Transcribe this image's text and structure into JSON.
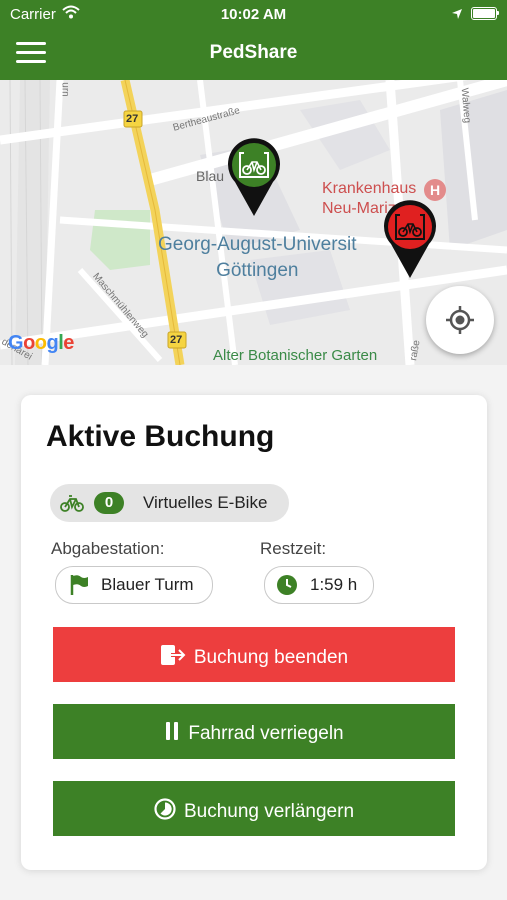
{
  "status_bar": {
    "carrier": "Carrier",
    "time": "10:02 AM"
  },
  "nav": {
    "title": "PedShare"
  },
  "map": {
    "labels": {
      "campus_line1": "Georg-August-Universit",
      "campus_line2": "Göttingen",
      "hospital_line1": "Krankenhaus",
      "hospital_line2": "Neu-Mariz",
      "garden": "Alter Botanischer Garten",
      "blau": "Blau",
      "street_bertheau": "Bertheaustraße",
      "street_muehlen": "Maschmühlenweg",
      "street_wall": "Walweg",
      "street_strasse": "raße",
      "street_denarei": "denarei",
      "street_urn": "urn",
      "route_27_top": "27",
      "route_27_bottom": "27",
      "hospital_marker": "H"
    },
    "google_logo": "Google",
    "colors": {
      "available_pin": "#3d8126",
      "occupied_pin": "#e02020"
    }
  },
  "booking": {
    "title": "Aktive Buchung",
    "bike_count": "0",
    "bike_name": "Virtuelles E-Bike",
    "return_label": "Abgabestation:",
    "return_station": "Blauer Turm",
    "remaining_label": "Restzeit:",
    "remaining_time": "1:59 h",
    "end_button": "Buchung beenden",
    "lock_button": "Fahrrad verriegeln",
    "extend_button": "Buchung verlängern"
  },
  "colors": {
    "brand_green": "#3d8126",
    "danger_red": "#ed3e3e"
  },
  "icons": [
    "menu-icon",
    "wifi-icon",
    "location-arrow-icon",
    "bike-icon",
    "my-location-icon",
    "flag-icon",
    "clock-icon",
    "exit-icon",
    "pause-icon",
    "timer-icon"
  ]
}
